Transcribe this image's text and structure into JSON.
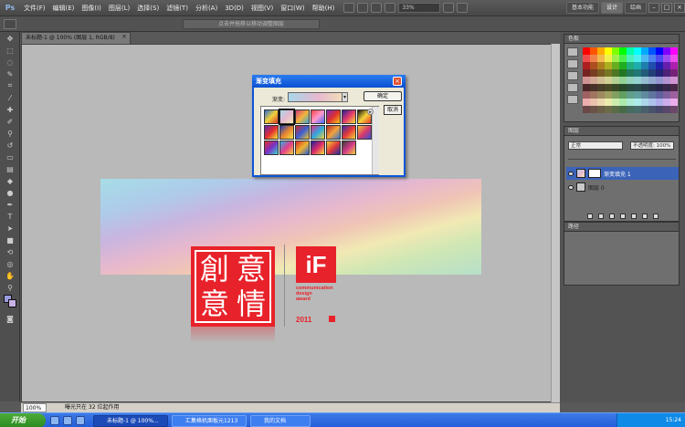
{
  "app": {
    "logo": "Ps",
    "menus": [
      "文件(F)",
      "编辑(E)",
      "图像(I)",
      "图层(L)",
      "选择(S)",
      "滤镜(T)",
      "分析(A)",
      "3D(D)",
      "视图(V)",
      "窗口(W)",
      "帮助(H)"
    ],
    "zoom": "33%",
    "workspaces": [
      "基本功能",
      "设计",
      "绘画"
    ],
    "active_workspace": "设计",
    "window_controls": [
      "–",
      "□",
      "×"
    ]
  },
  "options_bar": {
    "hint": "点击并拖移以移动调整图层"
  },
  "document": {
    "tab_title": "未标题-1 @ 100% (图层 1, RGB/8)",
    "close": "×"
  },
  "seal": {
    "chars": [
      "創",
      "意",
      "意",
      "情"
    ]
  },
  "if_logo": {
    "mark": "iF",
    "lines": [
      "communication",
      "design",
      "award"
    ],
    "year": "2011"
  },
  "dialog": {
    "title": "渐变填充",
    "gradient_label": "渐变:",
    "ok": "确定",
    "cancel": "取消",
    "close": "×"
  },
  "panels": {
    "swatches_tab": "色板",
    "layers_tab": "图层",
    "blend_mode": "正常",
    "opacity": "不透明度: 100%",
    "layers": [
      {
        "name": "渐变填充 1"
      },
      {
        "name": "图层 0"
      }
    ],
    "paths_tab": "路径"
  },
  "status": {
    "zoom": "100%",
    "text": "曝光只在 32 位起作用"
  },
  "taskbar": {
    "start": "开始",
    "tasks": [
      "未标题-1 @ 100%...",
      "汇集格机面板元1213",
      "我的文档"
    ],
    "clock": "15:24"
  },
  "colors": {
    "accent_red": "#e8222a",
    "titlebar_blue": "#0b4fd0"
  }
}
